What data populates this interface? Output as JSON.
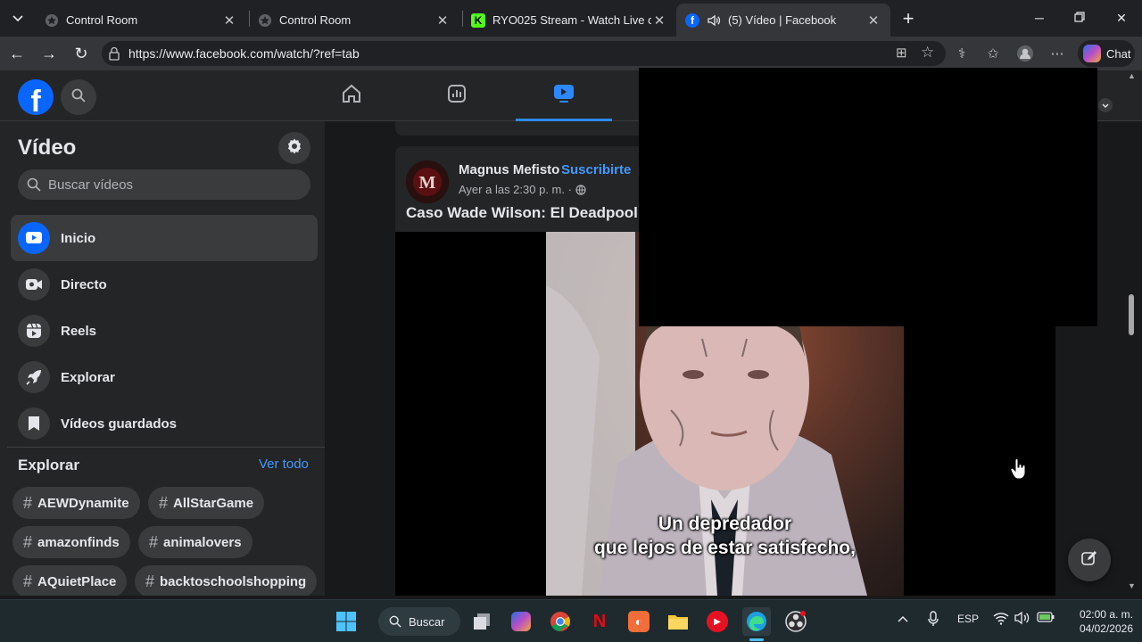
{
  "browser": {
    "tabs": [
      {
        "title": "Control Room",
        "active": false
      },
      {
        "title": "Control Room",
        "active": false
      },
      {
        "title": "RYO025 Stream - Watch Live on Ki",
        "active": false
      },
      {
        "title": "(5) Vídeo | Facebook",
        "active": true
      }
    ],
    "url": "https://www.facebook.com/watch/?ref=tab",
    "chat_label": "Chat"
  },
  "sidebar": {
    "title": "Vídeo",
    "search_placeholder": "Buscar vídeos",
    "items": [
      {
        "label": "Inicio",
        "icon": "video-play-icon",
        "active": true
      },
      {
        "label": "Directo",
        "icon": "live-camera-icon",
        "active": false
      },
      {
        "label": "Reels",
        "icon": "reels-icon",
        "active": false
      },
      {
        "label": "Explorar",
        "icon": "rocket-icon",
        "active": false
      },
      {
        "label": "Vídeos guardados",
        "icon": "bookmark-icon",
        "active": false
      }
    ],
    "explore": {
      "heading": "Explorar",
      "see_all": "Ver todo",
      "tags": [
        "AEWDynamite",
        "AllStarGame",
        "amazonfinds",
        "animalovers",
        "AQuietPlace",
        "backtoschoolshopping"
      ]
    }
  },
  "post": {
    "author": "Magnus Mefisto",
    "follow": "Suscribirte",
    "time": "Ayer a las 2:30 p. m. ·",
    "title": "Caso Wade Wilson: El Deadpool d",
    "subtitle_line1": "Un depredador",
    "subtitle_line2": "que lejos de estar satisfecho,"
  },
  "taskbar": {
    "search_label": "Buscar",
    "lang": "ESP",
    "time": "02:00 a. m.",
    "date": "04/02/2026"
  },
  "colors": {
    "fb_blue": "#0866ff",
    "link_blue": "#4599ff",
    "surface": "#242526",
    "background": "#18191a"
  }
}
